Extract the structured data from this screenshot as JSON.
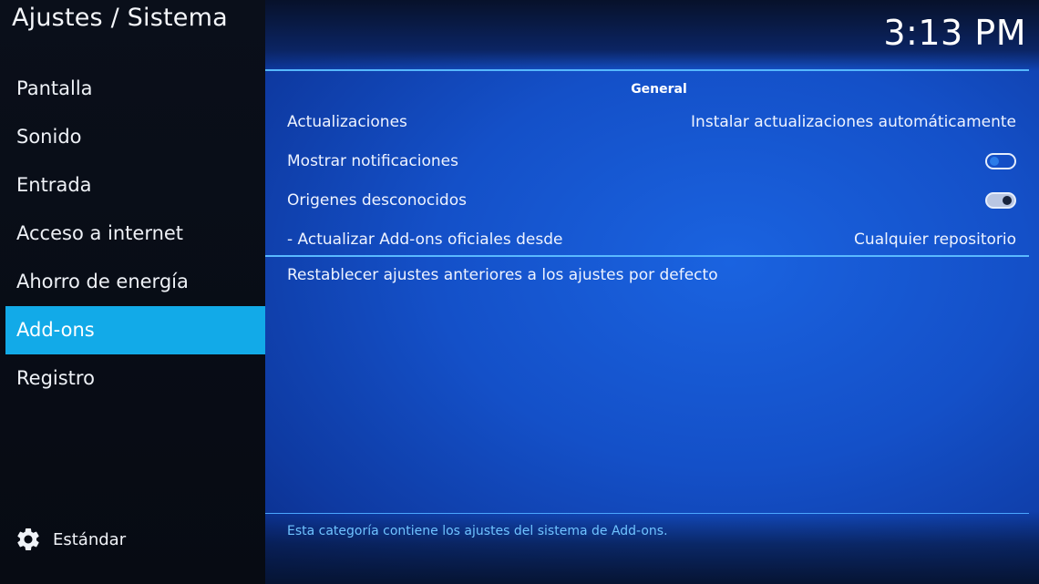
{
  "header": {
    "title": "Ajustes / Sistema",
    "clock": "3:13 PM"
  },
  "sidebar": {
    "items": [
      {
        "label": "Pantalla"
      },
      {
        "label": "Sonido"
      },
      {
        "label": "Entrada"
      },
      {
        "label": "Acceso a internet"
      },
      {
        "label": "Ahorro de energía"
      },
      {
        "label": "Add-ons",
        "active": true
      },
      {
        "label": "Registro"
      }
    ],
    "level": {
      "icon": "gear-icon",
      "label": "Estándar"
    }
  },
  "main": {
    "section_header": "General",
    "settings": [
      {
        "label": "Actualizaciones",
        "value": "Instalar actualizaciones automáticamente"
      },
      {
        "label": "Mostrar notificaciones",
        "toggle": "off"
      },
      {
        "label": "Origenes desconocidos",
        "toggle": "on"
      },
      {
        "label": "- Actualizar Add-ons oficiales desde",
        "value": "Cualquier repositorio"
      }
    ],
    "reset_label": "Restablecer ajustes anteriores a los ajustes por defecto",
    "description": "Esta categoría contiene los ajustes del sistema de Add-ons."
  },
  "colors": {
    "accent": "#12aae8",
    "panel_blue": "#1450c8",
    "sidebar_bg": "#0a0f1a",
    "description_text": "#6fc3ff"
  }
}
